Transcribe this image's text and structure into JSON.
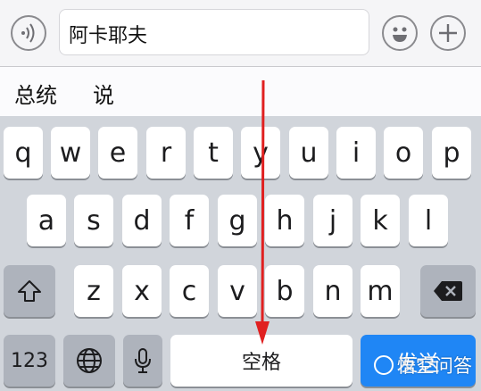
{
  "input": {
    "voice_icon": "voice-wave-icon",
    "text": "阿卡耶夫",
    "emoji_icon": "smiley-icon",
    "add_icon": "plus-icon"
  },
  "candidates": [
    "总统",
    "说"
  ],
  "keyboard": {
    "row1": [
      "q",
      "w",
      "e",
      "r",
      "t",
      "y",
      "u",
      "i",
      "o",
      "p"
    ],
    "row2": [
      "a",
      "s",
      "d",
      "f",
      "g",
      "h",
      "j",
      "k",
      "l"
    ],
    "row3": [
      "z",
      "x",
      "c",
      "v",
      "b",
      "n",
      "m"
    ],
    "shift_icon": "shift-arrow-icon",
    "delete_icon": "backspace-icon",
    "numbers_label": "123",
    "globe_icon": "globe-icon",
    "mic_icon": "microphone-icon",
    "space_label": "空格",
    "send_label": "发送"
  },
  "watermark": "悟空问答",
  "colors": {
    "send_key": "#1f86f5",
    "arrow": "#e02020"
  }
}
